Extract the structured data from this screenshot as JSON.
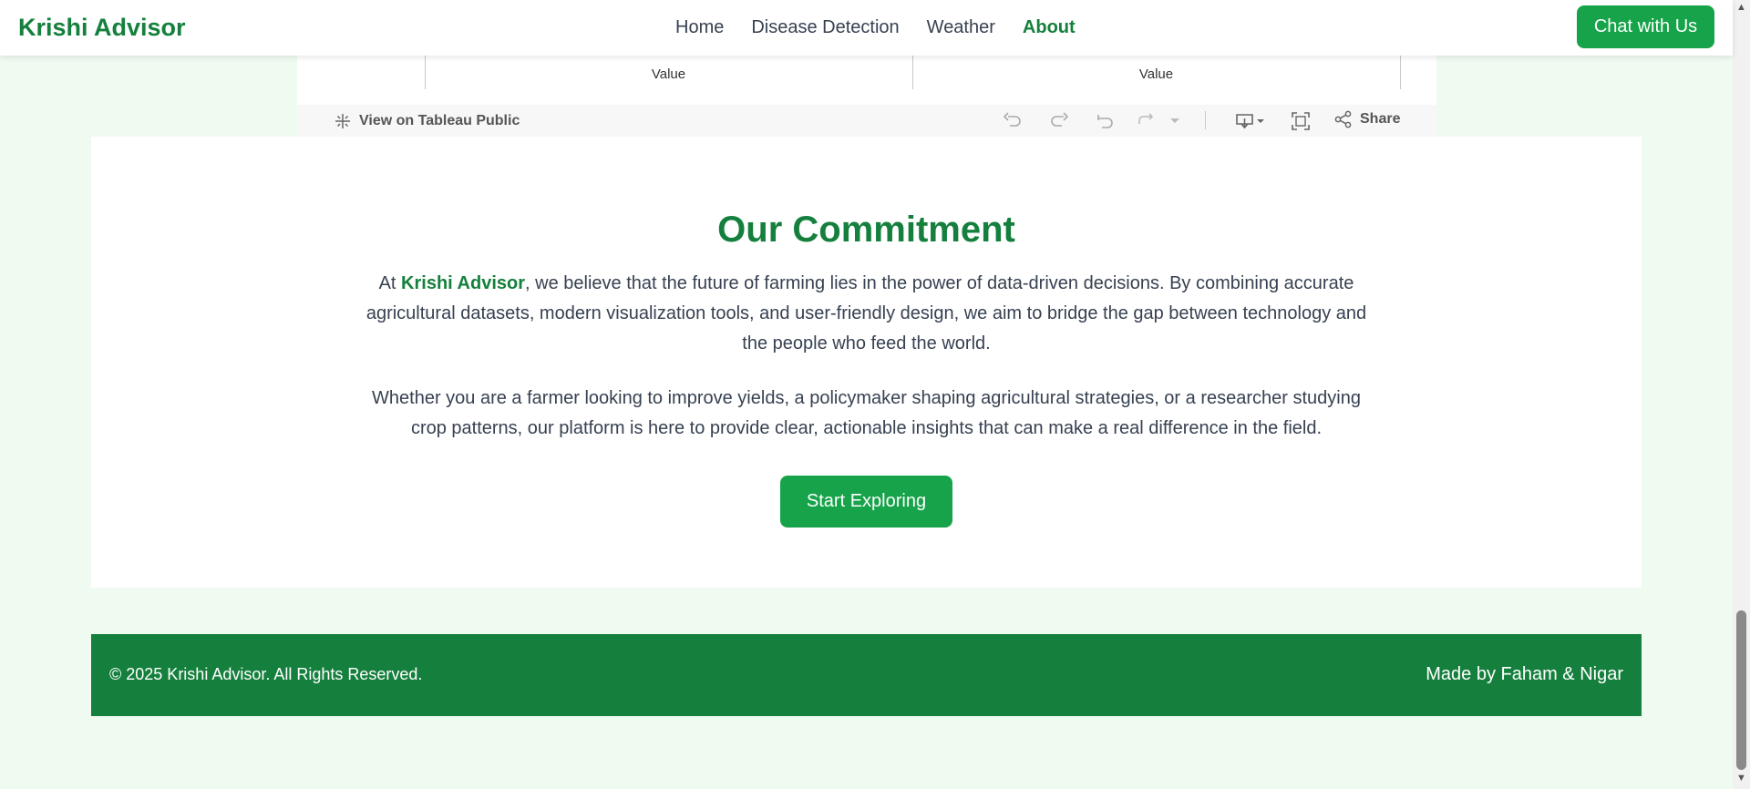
{
  "nav": {
    "brand": "Krishi Advisor",
    "links": [
      {
        "label": "Home"
      },
      {
        "label": "Disease Detection"
      },
      {
        "label": "Weather"
      },
      {
        "label": "About"
      }
    ],
    "active_link": "About",
    "chat_button": "Chat with Us"
  },
  "tableau": {
    "col_labels": [
      "Value",
      "Value"
    ],
    "view_link": "View on Tableau Public",
    "share_label": "Share",
    "icons": [
      "undo-icon",
      "redo-icon",
      "revert-icon",
      "pause-updates-icon",
      "dropdown-arrow-icon",
      "download-icon",
      "fullscreen-icon",
      "share-icon"
    ]
  },
  "commitment": {
    "title": "Our Commitment",
    "p1_prefix": "At ",
    "p1_highlight": "Krishi Advisor",
    "p1_rest": ", we believe that the future of farming lies in the power of data-driven decisions. By combining accurate agricultural datasets, modern visualization tools, and user-friendly design, we aim to bridge the gap between technology and the people who feed the world.",
    "p2": "Whether you are a farmer looking to improve yields, a policymaker shaping agricultural strategies, or a researcher studying crop patterns, our platform is here to provide clear, actionable insights that can make a real difference in the field.",
    "button": "Start Exploring"
  },
  "footer": {
    "copyright": "© 2025 Krishi Advisor. All Rights Reserved.",
    "credits": "Made by Faham & Nigar"
  },
  "colors": {
    "brand_green": "#15803d",
    "button_green": "#16a34a",
    "page_bg": "#effaf1"
  }
}
